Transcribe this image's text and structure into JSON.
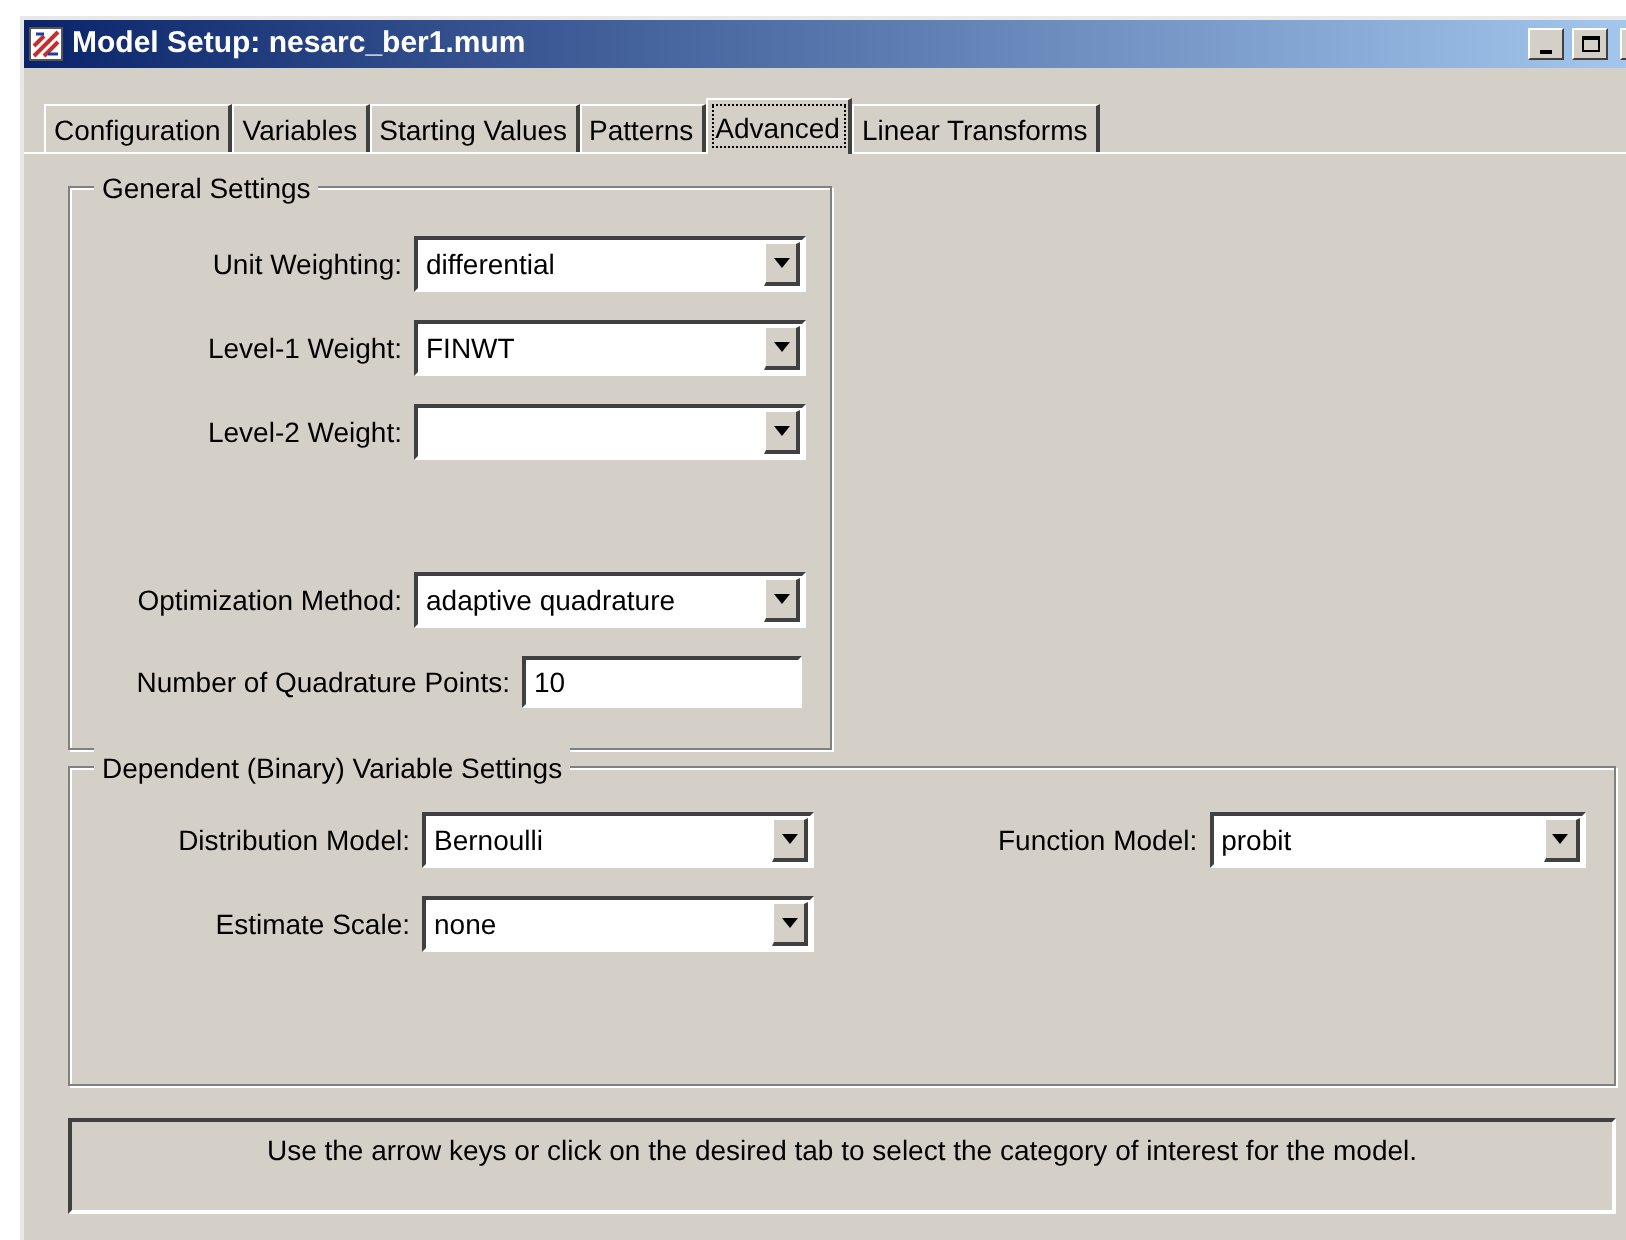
{
  "window": {
    "title": "Model Setup: nesarc_ber1.mum"
  },
  "tabs": [
    {
      "label": "Configuration",
      "selected": false
    },
    {
      "label": "Variables",
      "selected": false
    },
    {
      "label": "Starting Values",
      "selected": false
    },
    {
      "label": "Patterns",
      "selected": false
    },
    {
      "label": "Advanced",
      "selected": true
    },
    {
      "label": "Linear Transforms",
      "selected": false
    }
  ],
  "general_settings": {
    "title": "General Settings",
    "fields": [
      {
        "label": "Unit Weighting:",
        "kind": "dropdown",
        "value": "differential"
      },
      {
        "label": "Level-1 Weight:",
        "kind": "dropdown",
        "value": "FINWT"
      },
      {
        "label": "Level-2 Weight:",
        "kind": "dropdown"
      },
      {
        "label": "Optimization Method:",
        "kind": "dropdown",
        "value": "adaptive quadrature"
      },
      {
        "label": "Number of Quadrature Points:",
        "kind": "text",
        "value": "10"
      }
    ]
  },
  "dependent_settings": {
    "title": "Dependent (Binary) Variable Settings",
    "distribution_model": {
      "label": "Distribution Model:",
      "value": "Bernoulli"
    },
    "function_model": {
      "label": "Function Model:",
      "value": "probit"
    },
    "estimate_scale": {
      "label": "Estimate Scale:",
      "value": "none"
    }
  },
  "status_bar": {
    "text": "Use the arrow keys or click on the desired tab to select the category of interest for the model."
  }
}
